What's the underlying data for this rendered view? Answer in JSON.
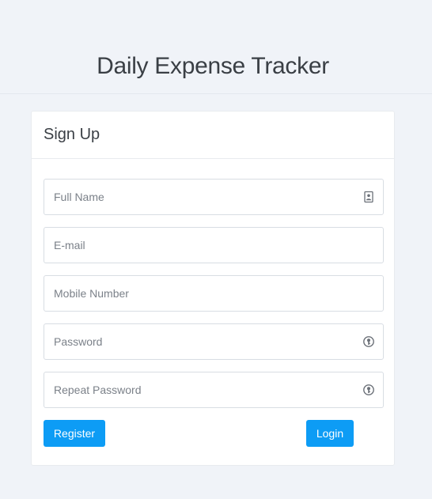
{
  "app": {
    "title": "Daily Expense Tracker"
  },
  "form": {
    "heading": "Sign Up",
    "fields": [
      {
        "placeholder": "Full Name",
        "value": "",
        "icon": "contact-card-icon"
      },
      {
        "placeholder": "E-mail",
        "value": "",
        "icon": ""
      },
      {
        "placeholder": "Mobile Number",
        "value": "",
        "icon": ""
      },
      {
        "placeholder": "Password",
        "value": "",
        "icon": "key-icon"
      },
      {
        "placeholder": "Repeat Password",
        "value": "",
        "icon": "key-icon"
      }
    ],
    "register_label": "Register",
    "login_label": "Login"
  },
  "colors": {
    "page_background": "#f0f3f8",
    "primary_button": "#0d9cf5",
    "title_text": "#3a3f45"
  }
}
